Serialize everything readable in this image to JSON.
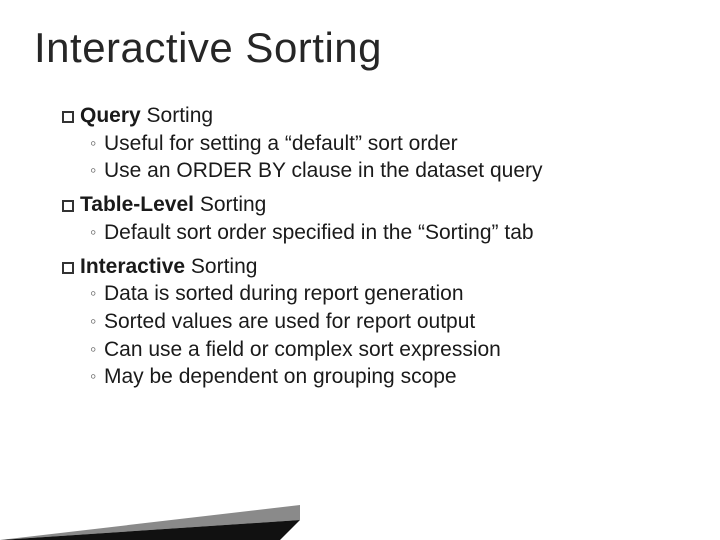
{
  "title": "Interactive Sorting",
  "sections": [
    {
      "lead": "Query",
      "rest": " Sorting",
      "subs": [
        "Useful for setting a “default” sort order",
        "Use an ORDER BY clause in the dataset query"
      ]
    },
    {
      "lead": "Table-Level",
      "rest": " Sorting",
      "subs": [
        "Default sort order specified in the “Sorting” tab"
      ]
    },
    {
      "lead": "Interactive",
      "rest": " Sorting",
      "subs": [
        "Data is sorted during report generation",
        "Sorted values are used for report output",
        "Can use a field or complex sort expression",
        "May be dependent on grouping scope"
      ]
    }
  ]
}
